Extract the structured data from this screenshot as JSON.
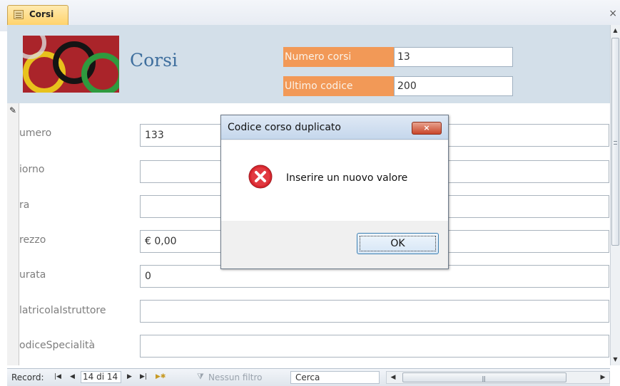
{
  "tab": {
    "label": "Corsi",
    "close_glyph": "×"
  },
  "header": {
    "title": "Corsi",
    "stats": [
      {
        "label": "Numero corsi",
        "value": "13"
      },
      {
        "label": "Ultimo codice",
        "value": "200"
      }
    ]
  },
  "fields": [
    {
      "label": "umero",
      "value": "133"
    },
    {
      "label": "iorno",
      "value": ""
    },
    {
      "label": "ra",
      "value": ""
    },
    {
      "label": "rezzo",
      "value": "€ 0,00"
    },
    {
      "label": "urata",
      "value": "0"
    },
    {
      "label": "latricolaIstruttore",
      "value": ""
    },
    {
      "label": "odiceSpecialità",
      "value": ""
    }
  ],
  "navigation": {
    "record_label": "Record:",
    "current": "14 di 14",
    "filter": "Nessun filtro",
    "search": "Cerca"
  },
  "dialog": {
    "title": "Codice corso duplicato",
    "message": "Inserire un nuovo valore",
    "ok_label": "OK",
    "close_glyph": "×"
  },
  "colors": {
    "header_band": "#d3dfe9",
    "stat_label": "#f29957",
    "title": "#3f6f9e",
    "tab": "#ffd36c"
  },
  "icons": [
    "form-icon",
    "close-icon",
    "pencil-icon",
    "error-icon",
    "first-record-icon",
    "previous-record-icon",
    "next-record-icon",
    "last-record-icon",
    "new-record-icon",
    "filter-icon"
  ]
}
